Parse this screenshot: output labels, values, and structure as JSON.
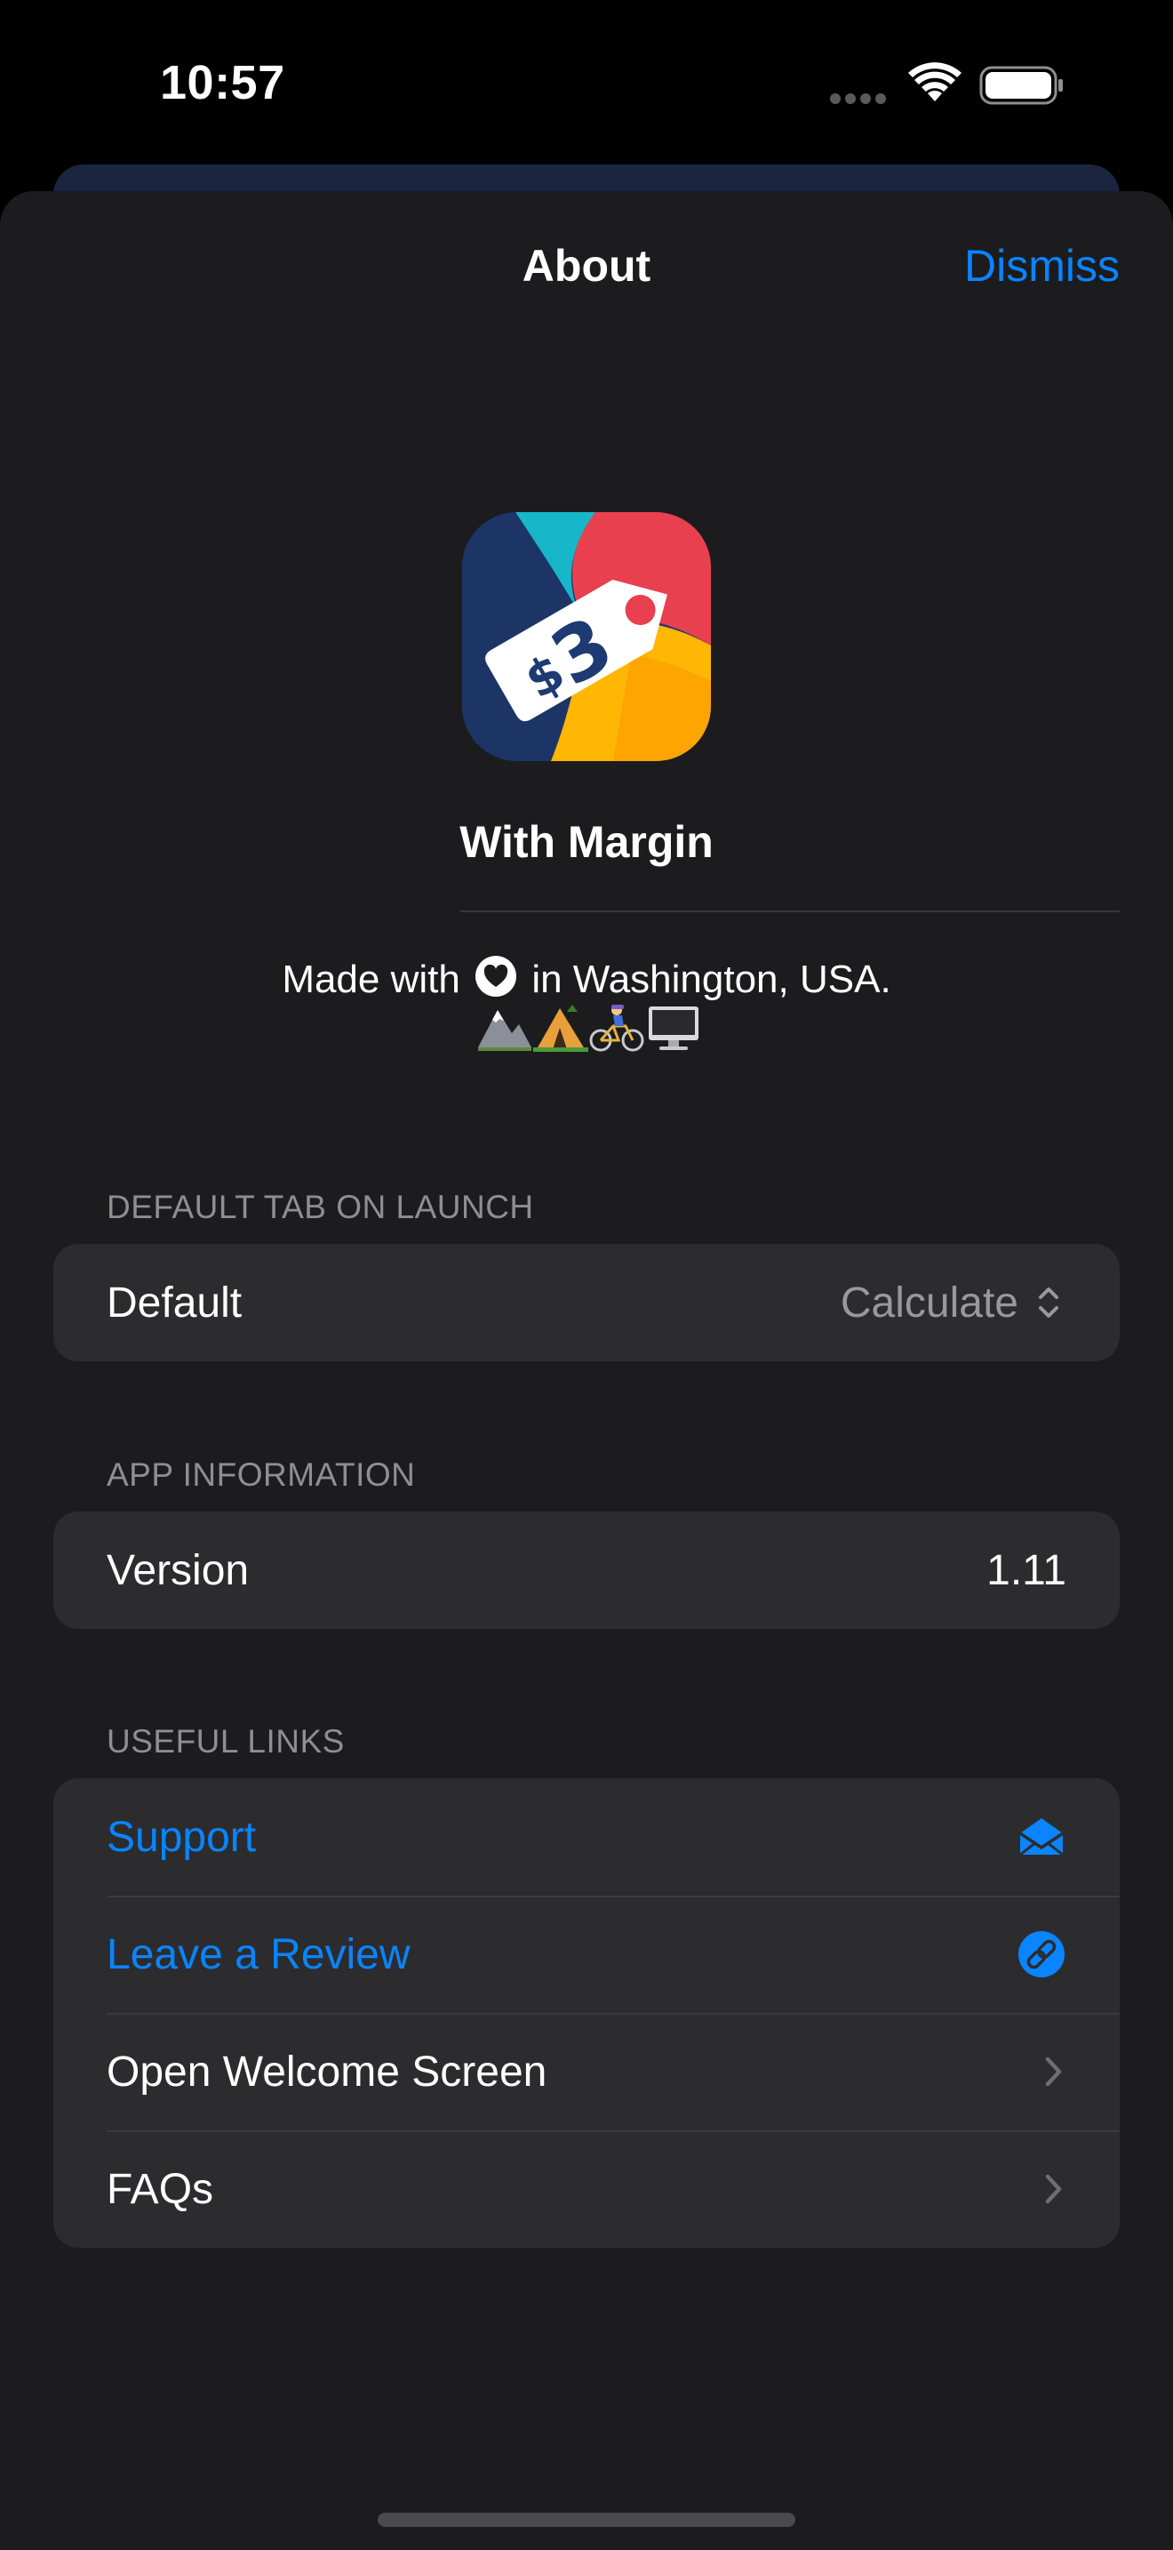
{
  "status_bar": {
    "time": "10:57"
  },
  "nav": {
    "title": "About",
    "dismiss": "Dismiss"
  },
  "app": {
    "name": "With Margin",
    "made_prefix": "Made with",
    "made_suffix": "in Washington, USA."
  },
  "sections": {
    "default_tab": {
      "header": "DEFAULT TAB ON LAUNCH",
      "row_label": "Default",
      "row_value": "Calculate"
    },
    "app_info": {
      "header": "APP INFORMATION",
      "row_label": "Version",
      "row_value": "1.11"
    },
    "useful_links": {
      "header": "USEFUL LINKS",
      "items": [
        {
          "label": "Support",
          "icon": "envelope-icon"
        },
        {
          "label": "Leave a Review",
          "icon": "link-icon"
        },
        {
          "label": "Open Welcome Screen",
          "icon": "chevron-right-icon"
        },
        {
          "label": "FAQs",
          "icon": "chevron-right-icon"
        }
      ]
    }
  },
  "colors": {
    "accent": "#0a84ff",
    "sheet_bg": "#1c1c1e",
    "cell_bg": "#2c2c2e",
    "secondary_text": "#8e8e93"
  }
}
